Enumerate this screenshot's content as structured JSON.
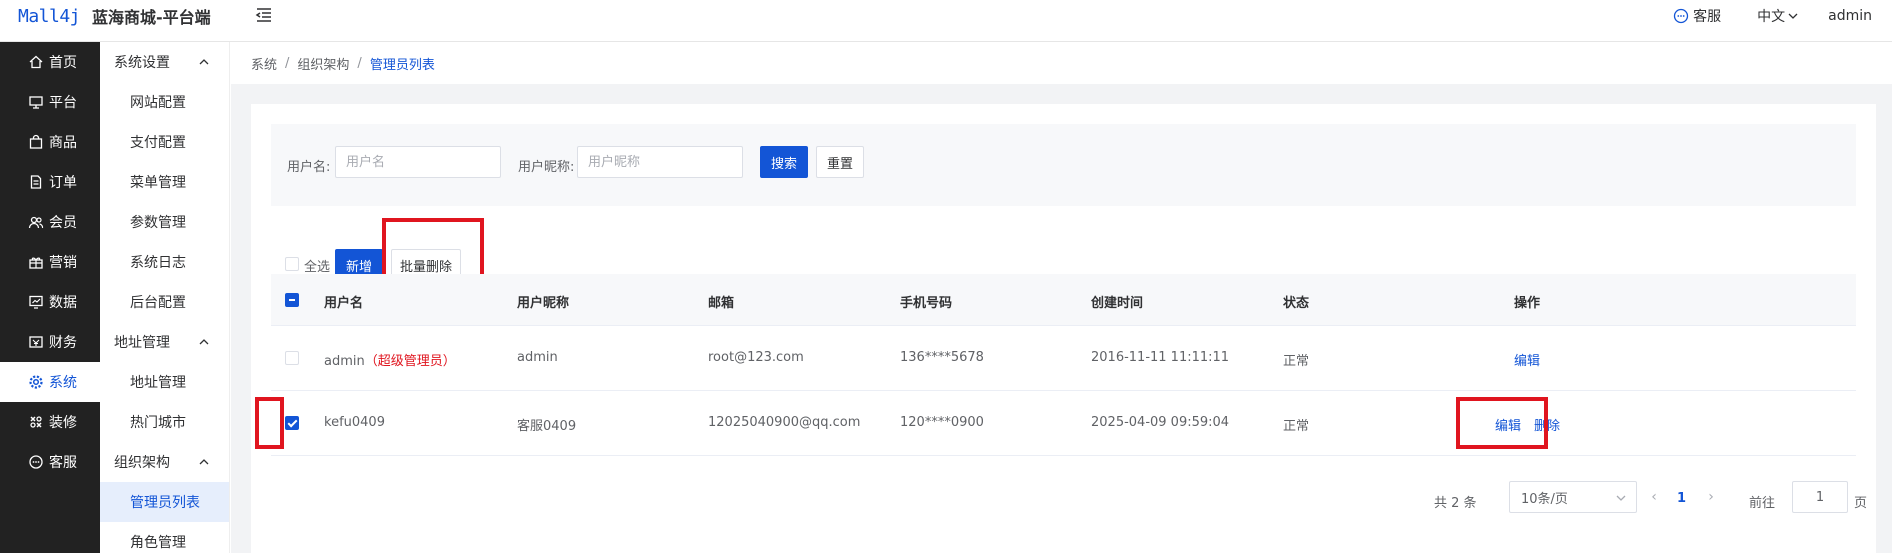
{
  "header": {
    "logo_mark": "Mall4j",
    "app_name": "蓝海商城-平台端",
    "kefu_label": "客服",
    "language": "中文",
    "user": "admin"
  },
  "sidebar": {
    "items": [
      {
        "label": "首页",
        "icon": "home-icon"
      },
      {
        "label": "平台",
        "icon": "monitor-icon"
      },
      {
        "label": "商品",
        "icon": "bag-icon"
      },
      {
        "label": "订单",
        "icon": "document-icon"
      },
      {
        "label": "会员",
        "icon": "users-icon"
      },
      {
        "label": "营销",
        "icon": "gift-icon"
      },
      {
        "label": "数据",
        "icon": "chart-icon"
      },
      {
        "label": "财务",
        "icon": "wallet-icon"
      },
      {
        "label": "系统",
        "icon": "gear-icon"
      },
      {
        "label": "装修",
        "icon": "decorate-icon"
      },
      {
        "label": "客服",
        "icon": "chat-icon"
      }
    ],
    "active_index": 8
  },
  "submenu": {
    "groups": [
      {
        "label": "系统设置",
        "items": [
          "网站配置",
          "支付配置",
          "菜单管理",
          "参数管理",
          "系统日志",
          "后台配置"
        ]
      },
      {
        "label": "地址管理",
        "items": [
          "地址管理",
          "热门城市"
        ]
      },
      {
        "label": "组织架构",
        "items": [
          "管理员列表",
          "角色管理"
        ]
      }
    ],
    "active_item": "管理员列表"
  },
  "breadcrumb": [
    "系统",
    "组织架构",
    "管理员列表"
  ],
  "search": {
    "username_label": "用户名:",
    "username_placeholder": "用户名",
    "nickname_label": "用户昵称:",
    "nickname_placeholder": "用户昵称",
    "search_button": "搜索",
    "reset_button": "重置"
  },
  "toolbar": {
    "select_all": "全选",
    "add_button": "新增",
    "batch_delete_button": "批量删除"
  },
  "table": {
    "columns": [
      "用户名",
      "用户昵称",
      "邮箱",
      "手机号码",
      "创建时间",
      "状态",
      "操作"
    ],
    "rows": [
      {
        "username": "admin",
        "tag": "（超级管理员）",
        "nickname": "admin",
        "email": "root@123.com",
        "phone": "136****5678",
        "created": "2016-11-11 11:11:11",
        "status": "正常",
        "actions": [
          "编辑"
        ],
        "checked": false
      },
      {
        "username": "kefu0409",
        "tag": "",
        "nickname": "客服0409",
        "email": "12025040900@qq.com",
        "phone": "120****0900",
        "created": "2025-04-09 09:59:04",
        "status": "正常",
        "actions": [
          "编辑",
          "删除"
        ],
        "checked": true
      }
    ]
  },
  "pagination": {
    "total": "共 2 条",
    "page_size": "10条/页",
    "current_page": "1",
    "goto_label": "前往",
    "goto_value": "1",
    "page_suffix": "页"
  },
  "colors": {
    "primary": "#1355d6",
    "highlight": "#e0151f",
    "sidebar_bg": "#222222"
  }
}
